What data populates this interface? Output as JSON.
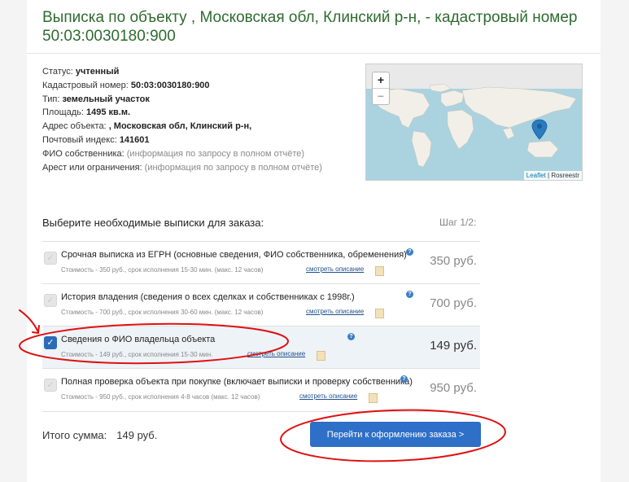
{
  "title": {
    "line1": "Выписка по объекту , Московская обл, Клинский р-н, - кадастровый номер",
    "line2": "50:03:0030180:900"
  },
  "info": {
    "status_label": "Статус:",
    "status_value": "учтенный",
    "cad_label": "Кадастровый номер:",
    "cad_value": "50:03:0030180:900",
    "type_label": "Тип:",
    "type_value": "земельный участок",
    "area_label": "Площадь:",
    "area_value": "1495 кв.м.",
    "address_label": "Адрес объекта:",
    "address_value": ", Московская обл, Клинский р-н,",
    "zip_label": "Почтовый индекс:",
    "zip_value": "141601",
    "owner_label": "ФИО собственника:",
    "owner_value": "(информация по запросу в полном отчёте)",
    "arrest_label": "Арест или ограничения:",
    "arrest_value": "(информация по запросу в полном отчёте)"
  },
  "map": {
    "zoom_in": "+",
    "zoom_out": "−",
    "attribution_link": "Leaflet",
    "attribution_sep": " | ",
    "attribution_text": "Rosreestr"
  },
  "order": {
    "heading": "Выберите необходимые выписки для заказа:",
    "step": "Шаг 1/2:",
    "options": [
      {
        "name": "Срочная выписка из ЕГРН (основные сведения, ФИО собственника, обременения)",
        "cost": "Стоимость - 350 руб., срок исполнения 15-30 мин. (макс. 12 часов)",
        "desc": "смотреть описание",
        "price": "350 руб.",
        "checked": false
      },
      {
        "name": "История владения (сведения о всех сделках и собственниках с 1998г.)",
        "cost": "Стоимость - 700 руб., срок исполнения 30-60 мин. (макс. 12 часов)",
        "desc": "смотреть описание",
        "price": "700 руб.",
        "checked": false
      },
      {
        "name": "Сведения о ФИО владельца объекта",
        "cost": "Стоимость - 149 руб., срок исполнения 15-30 мин.",
        "desc": "смотреть описание",
        "price": "149 руб.",
        "checked": true
      },
      {
        "name": "Полная проверка объекта при покупке (включает выписки и проверку собственника)",
        "cost": "Стоимость - 950 руб., срок исполнения 4-8 часов (макс. 12 часов)",
        "desc": "смотреть описание",
        "price": "950 руб.",
        "checked": false
      }
    ],
    "checkmark": "✓",
    "help": "?"
  },
  "total": {
    "label": "Итого сумма:",
    "value": "149 руб."
  },
  "submit_button": "Перейти к оформлению заказа >",
  "colors": {
    "title": "#2e6b2f",
    "button": "#2e6fc7",
    "annotation": "#e01010",
    "selected_row": "#eef3f8"
  }
}
